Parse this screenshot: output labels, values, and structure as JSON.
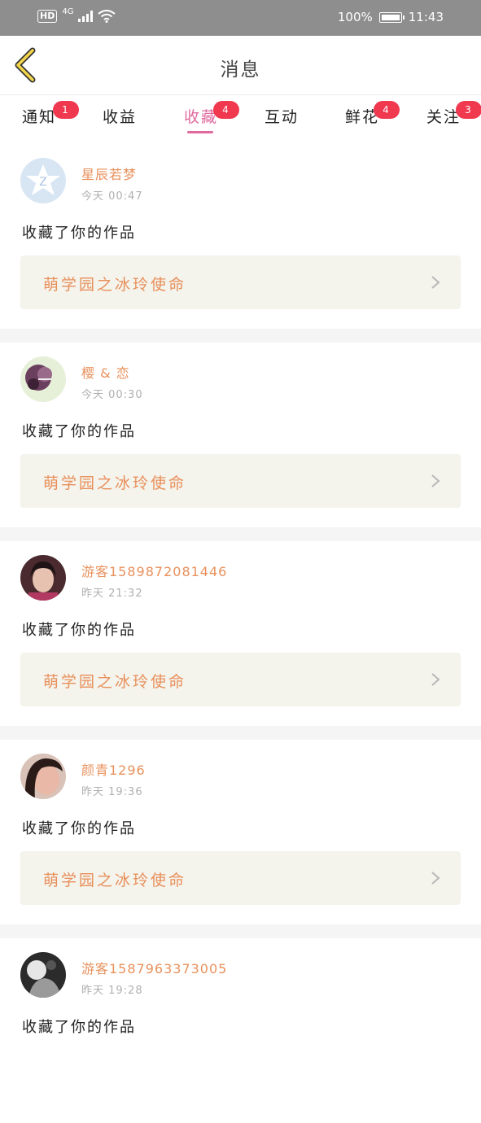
{
  "status_bar": {
    "hd": "HD",
    "signal": "4G",
    "battery": "100%",
    "time": "11:43"
  },
  "header": {
    "title": "消息",
    "back_icon": "chevron-left-icon"
  },
  "tabs": [
    {
      "label": "通知",
      "badge": "1"
    },
    {
      "label": "收益",
      "badge": ""
    },
    {
      "label": "收藏",
      "badge": "4",
      "active": true
    },
    {
      "label": "互动",
      "badge": ""
    },
    {
      "label": "鲜花",
      "badge": "4"
    },
    {
      "label": "关注",
      "badge": "3"
    }
  ],
  "colors": {
    "accent": "#e06a9e",
    "badge": "#f0384f",
    "username": "#e8905b",
    "card_bg": "#f4f3ec"
  },
  "messages": [
    {
      "user": "星辰若梦",
      "time": "今天 00:47",
      "action": "收藏了你的作品",
      "work": "萌学园之冰玲使命"
    },
    {
      "user": "樱 & 恋",
      "time": "今天 00:30",
      "action": "收藏了你的作品",
      "work": "萌学园之冰玲使命"
    },
    {
      "user": "游客1589872081446",
      "time": "昨天 21:32",
      "action": "收藏了你的作品",
      "work": "萌学园之冰玲使命"
    },
    {
      "user": "颜青1296",
      "time": "昨天 19:36",
      "action": "收藏了你的作品",
      "work": "萌学园之冰玲使命"
    },
    {
      "user": "游客1587963373005",
      "time": "昨天 19:28",
      "action": "收藏了你的作品",
      "work": ""
    }
  ]
}
